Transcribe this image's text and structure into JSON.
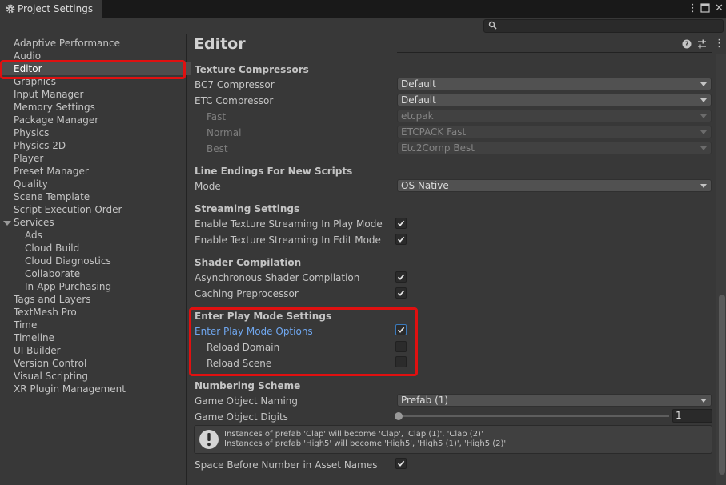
{
  "window": {
    "tab_title": "Project Settings",
    "search": {
      "placeholder": ""
    }
  },
  "sidebar": {
    "items": [
      {
        "label": "Adaptive Performance"
      },
      {
        "label": "Audio"
      },
      {
        "label": "Editor",
        "selected": true
      },
      {
        "label": "Graphics"
      },
      {
        "label": "Input Manager"
      },
      {
        "label": "Memory Settings"
      },
      {
        "label": "Package Manager"
      },
      {
        "label": "Physics"
      },
      {
        "label": "Physics 2D"
      },
      {
        "label": "Player"
      },
      {
        "label": "Preset Manager"
      },
      {
        "label": "Quality"
      },
      {
        "label": "Scene Template"
      },
      {
        "label": "Script Execution Order"
      },
      {
        "label": "Services",
        "expanded": true
      },
      {
        "label": "Ads",
        "child": true
      },
      {
        "label": "Cloud Build",
        "child": true
      },
      {
        "label": "Cloud Diagnostics",
        "child": true
      },
      {
        "label": "Collaborate",
        "child": true
      },
      {
        "label": "In-App Purchasing",
        "child": true
      },
      {
        "label": "Tags and Layers"
      },
      {
        "label": "TextMesh Pro"
      },
      {
        "label": "Time"
      },
      {
        "label": "Timeline"
      },
      {
        "label": "UI Builder"
      },
      {
        "label": "Version Control"
      },
      {
        "label": "Visual Scripting"
      },
      {
        "label": "XR Plugin Management"
      }
    ]
  },
  "main": {
    "title": "Editor",
    "texture_compressors": {
      "header": "Texture Compressors",
      "bc7": {
        "label": "BC7 Compressor",
        "value": "Default"
      },
      "etc": {
        "label": "ETC Compressor",
        "value": "Default"
      },
      "fast": {
        "label": "Fast",
        "value": "etcpak"
      },
      "normal": {
        "label": "Normal",
        "value": "ETCPACK Fast"
      },
      "best": {
        "label": "Best",
        "value": "Etc2Comp Best"
      }
    },
    "line_endings": {
      "header": "Line Endings For New Scripts",
      "mode": {
        "label": "Mode",
        "value": "OS Native"
      }
    },
    "streaming": {
      "header": "Streaming Settings",
      "play_mode": {
        "label": "Enable Texture Streaming In Play Mode",
        "checked": true
      },
      "edit_mode": {
        "label": "Enable Texture Streaming In Edit Mode",
        "checked": true
      }
    },
    "shader": {
      "header": "Shader Compilation",
      "async": {
        "label": "Asynchronous Shader Compilation",
        "checked": true
      },
      "caching": {
        "label": "Caching Preprocessor",
        "checked": true
      }
    },
    "play_mode": {
      "header": "Enter Play Mode Settings",
      "options": {
        "label": "Enter Play Mode Options",
        "checked": true
      },
      "reload_domain": {
        "label": "Reload Domain",
        "checked": false
      },
      "reload_scene": {
        "label": "Reload Scene",
        "checked": false
      }
    },
    "numbering": {
      "header": "Numbering Scheme",
      "naming": {
        "label": "Game Object Naming",
        "value": "Prefab (1)"
      },
      "digits": {
        "label": "Game Object Digits",
        "value": "1",
        "slider_fraction": 0.0
      },
      "help_line1": "Instances of prefab 'Clap' will become 'Clap', 'Clap (1)', 'Clap (2)'",
      "help_line2": "Instances of prefab 'High5' will become 'High5', 'High5 (1)', 'High5 (2)'",
      "space_before": {
        "label": "Space Before Number in Asset Names",
        "checked": true
      }
    }
  },
  "colors": {
    "highlight": "#e01010",
    "link": "#6fa6ee",
    "background": "#383838"
  }
}
